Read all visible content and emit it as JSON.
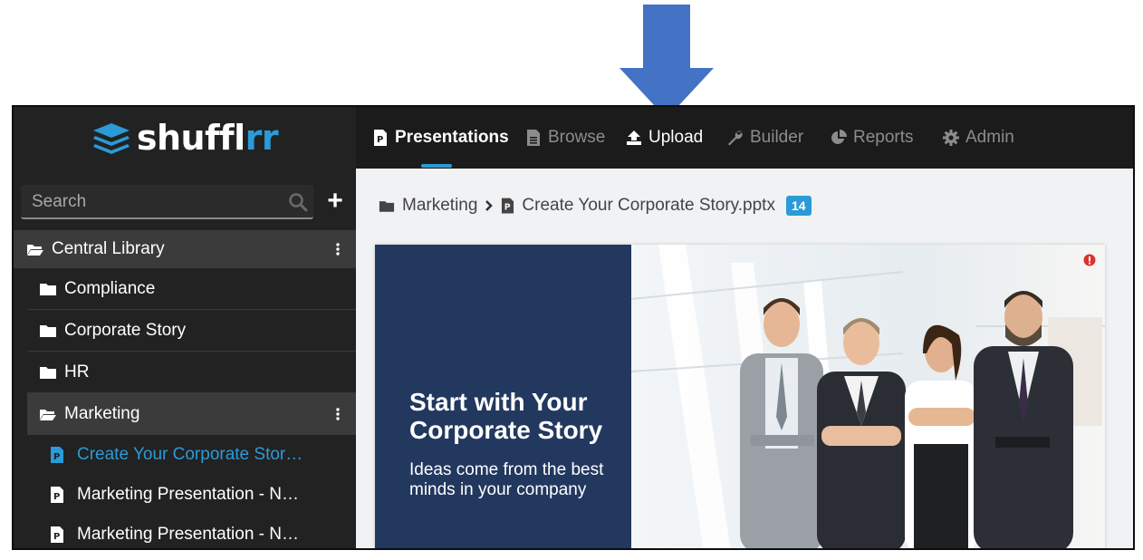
{
  "app": {
    "logo_text_main": "shuffl",
    "logo_text_accent": "rr",
    "brand_color": "#2a9bd7"
  },
  "sidebar": {
    "search": {
      "placeholder": "Search",
      "value": ""
    },
    "add_label": "+",
    "root": {
      "label": "Central Library",
      "icon": "folder-open-icon"
    },
    "folders": [
      {
        "label": "Compliance",
        "icon": "folder-icon"
      },
      {
        "label": "Corporate Story",
        "icon": "folder-icon"
      },
      {
        "label": "HR",
        "icon": "folder-icon"
      },
      {
        "label": "Marketing",
        "icon": "folder-open-icon"
      }
    ],
    "files": [
      {
        "label": "Create Your Corporate Stor…",
        "active": true
      },
      {
        "label": "Marketing Presentation - N…",
        "active": false
      },
      {
        "label": "Marketing Presentation - N…",
        "active": false
      }
    ]
  },
  "nav": {
    "tabs": [
      {
        "label": "Presentations",
        "icon": "powerpoint-file-icon",
        "active": true
      },
      {
        "label": "Browse",
        "icon": "document-icon",
        "active": false
      },
      {
        "label": "Upload",
        "icon": "upload-icon",
        "active": false
      },
      {
        "label": "Builder",
        "icon": "wrench-icon",
        "active": false
      },
      {
        "label": "Reports",
        "icon": "pie-chart-icon",
        "active": false
      },
      {
        "label": "Admin",
        "icon": "gear-icon",
        "active": false
      }
    ]
  },
  "breadcrumb": {
    "folder": "Marketing",
    "file": "Create Your Corporate Story.pptx",
    "badge": "14"
  },
  "slide": {
    "title": "Start with Your Corporate Story",
    "subtitle": "Ideas come from the best minds in your company",
    "panel_color": "#22385f"
  },
  "annotation": {
    "arrow_color": "#4472c4",
    "points_to": "Upload"
  }
}
